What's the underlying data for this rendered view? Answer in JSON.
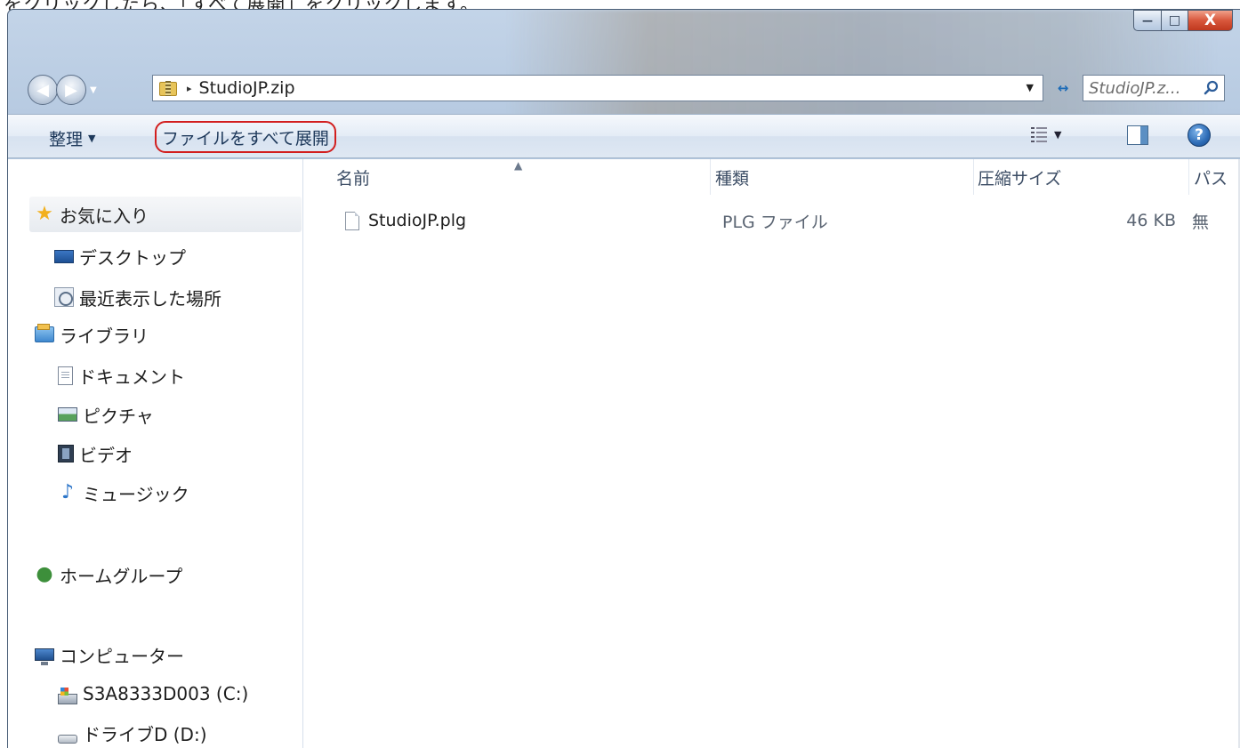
{
  "caption": "をクリックしたら、「すべて展開」をクリックします。",
  "window": {
    "buttons": {
      "minimize": "—",
      "maximize": "□",
      "close": "X"
    }
  },
  "address": {
    "path": "StudioJP.zip",
    "separator": "▸",
    "dropdown": "▼",
    "refresh": "↔"
  },
  "search": {
    "placeholder": "StudioJP.z..."
  },
  "command_bar": {
    "organize": "整理",
    "organize_arrow": "▼",
    "extract_all": "ファイルをすべて展開",
    "views_arrow": "▼",
    "help": "?"
  },
  "sidebar": {
    "items": [
      {
        "label": "お気に入り",
        "icon": "star-icon"
      },
      {
        "label": "デスクトップ",
        "icon": "desktop-icon"
      },
      {
        "label": "最近表示した場所",
        "icon": "recent-places-icon"
      },
      {
        "label": "ライブラリ",
        "icon": "library-icon"
      },
      {
        "label": "ドキュメント",
        "icon": "document-icon"
      },
      {
        "label": "ピクチャ",
        "icon": "picture-icon"
      },
      {
        "label": "ビデオ",
        "icon": "video-icon"
      },
      {
        "label": "ミュージック",
        "icon": "music-icon"
      },
      {
        "label": "ホームグループ",
        "icon": "homegroup-icon"
      },
      {
        "label": "コンピューター",
        "icon": "computer-icon"
      },
      {
        "label": "S3A8333D003 (C:)",
        "icon": "drive-c-icon"
      },
      {
        "label": "ドライブD (D:)",
        "icon": "drive-d-icon"
      }
    ]
  },
  "file_list": {
    "columns": [
      "名前",
      "種類",
      "圧縮サイズ",
      "パス"
    ],
    "sort_indicator": "▲",
    "rows": [
      {
        "name": "StudioJP.plg",
        "type": "PLG ファイル",
        "size": "46 KB",
        "extra": "無"
      }
    ]
  },
  "colors": {
    "accent_red": "#d21e1e",
    "title_gradient": "#b8cbe2",
    "command_text": "#1e395b"
  }
}
